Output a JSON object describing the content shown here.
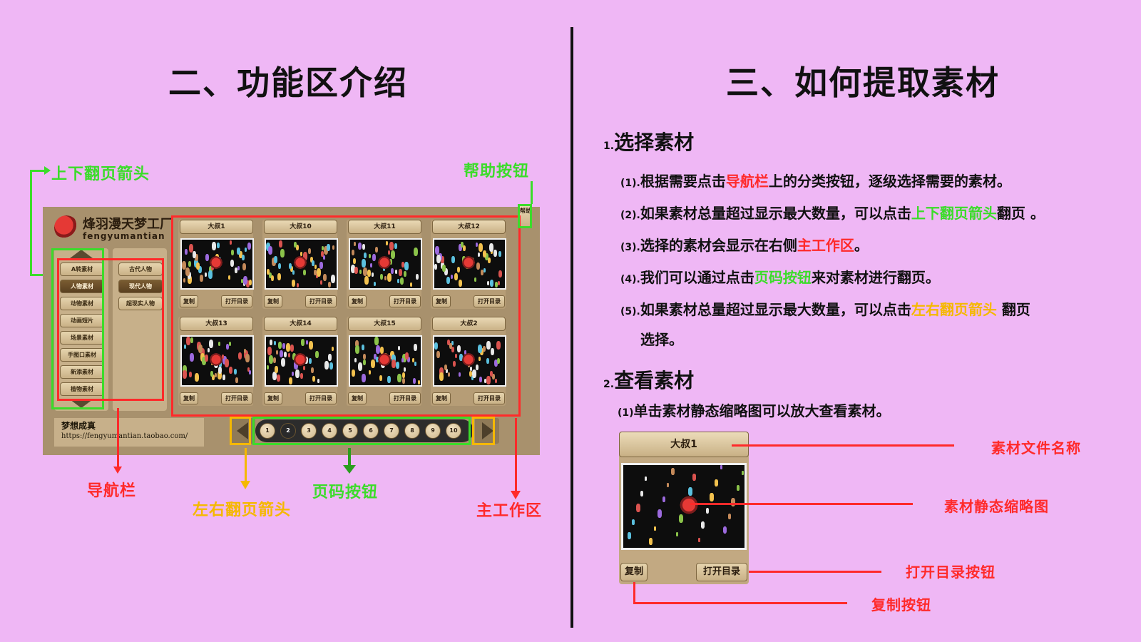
{
  "left": {
    "title": "二、功能区介绍",
    "app": {
      "logo_text": "烽羽漫天梦工厂",
      "logo_sub": "fengyumantian",
      "help_label": "帮助",
      "nav_primary": [
        "A转素材",
        "人物素材",
        "动物素材",
        "动画短片",
        "场景素材",
        "手图口素材",
        "新添素材",
        "植物素材"
      ],
      "nav_secondary": [
        "古代人物",
        "现代人物",
        "超现实人物"
      ],
      "cards": [
        {
          "title": "大叔1"
        },
        {
          "title": "大叔10"
        },
        {
          "title": "大叔11"
        },
        {
          "title": "大叔12"
        },
        {
          "title": "大叔13"
        },
        {
          "title": "大叔14"
        },
        {
          "title": "大叔15"
        },
        {
          "title": "大叔2"
        }
      ],
      "copy_label": "复制",
      "open_label": "打开目录",
      "shop_name": "梦想成真",
      "shop_url": "https://fengyumantian.taobao.com/",
      "pages": [
        "1",
        "2",
        "3",
        "4",
        "5",
        "6",
        "7",
        "8",
        "9",
        "10"
      ],
      "active_page": "2"
    },
    "labels": {
      "up_down_arrow": "上下翻页箭头",
      "help_button": "帮助按钮",
      "nav_bar": "导航栏",
      "left_right_arrow": "左右翻页箭头",
      "page_buttons": "页码按钮",
      "main_area": "主工作区"
    }
  },
  "right": {
    "title": "三、如何提取素材",
    "section1": {
      "heading": "选择素材",
      "number": "1.",
      "items": [
        {
          "num": "(1).",
          "pre": "根据需要点击",
          "hl": "导航栏",
          "post": "上的分类按钮，逐级选择需要的素材。"
        },
        {
          "num": "(2).",
          "pre": "如果素材总量超过显示最大数量，可以点击",
          "hl": "上下翻页箭头",
          "post": "翻页 。"
        },
        {
          "num": "(3).",
          "pre": "选择的素材会显示在右侧",
          "hl": "主工作区",
          "post": "。"
        },
        {
          "num": "(4).",
          "pre": "我们可以通过点击",
          "hl": "页码按钮",
          "post": "来对素材进行翻页。"
        },
        {
          "num": "(5).",
          "pre": "如果素材总量超过显示最大数量，可以点击",
          "hl": "左右翻页箭头",
          "post": " 翻页"
        }
      ],
      "item5_cont": "选择。"
    },
    "section2": {
      "heading": "查看素材",
      "number": "2.",
      "item": {
        "num": "(1)",
        "text": "单击素材静态缩略图可以放大查看素材。"
      }
    },
    "sample_card": {
      "title": "大叔1",
      "copy": "复制",
      "open": "打开目录"
    },
    "callouts": {
      "file_name": "素材文件名称",
      "thumbnail": "素材静态缩略图",
      "open_btn": "打开目录按钮",
      "copy_btn": "复制按钮"
    }
  },
  "colors": {
    "background": "#efb7f5",
    "red": "#ff2a2a",
    "green": "#3bdc2a",
    "orange": "#f5b800"
  }
}
